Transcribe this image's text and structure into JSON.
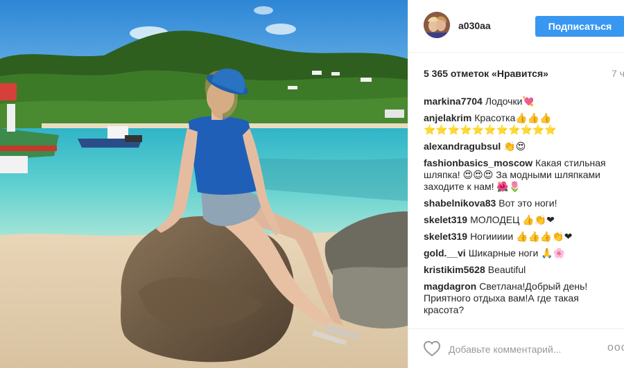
{
  "post": {
    "username": "a030aa",
    "follow_label": "Подписаться",
    "likes": "5 365 отметок «Нравится»",
    "time": "7 ч"
  },
  "comments": [
    {
      "user": "markina7704",
      "text": "Лодочки💘"
    },
    {
      "user": "anjelakrim",
      "text": "Красотка👍👍👍⭐⭐⭐⭐⭐⭐⭐⭐⭐⭐⭐"
    },
    {
      "user": "alexandragubsul",
      "text": "👏😍"
    },
    {
      "user": "fashionbasics_moscow",
      "text": "Какая стильная шляпка! 😍😍😍 За модными шляпками заходите к нам! 🌺🌷"
    },
    {
      "user": "shabelnikova83",
      "text": "Вот это ноги!"
    },
    {
      "user": "skelet319",
      "text": "МОЛОДЕЦ 👍👏❤"
    },
    {
      "user": "skelet319",
      "text": "Ногиииии 👍👍👍👏❤"
    },
    {
      "user": "gold.__vi",
      "text": "Шикарные ноги 🙏🌸"
    },
    {
      "user": "kristikim5628",
      "text": "Beautiful"
    },
    {
      "user": "magdagron",
      "text": "Светлана!Добрый день!Приятного отдыха вам!А где такая красота?"
    }
  ],
  "footer": {
    "comment_placeholder": "Добавьте комментарий...",
    "more_label": "ooo",
    "heart_icon": "heart-outline-icon"
  },
  "colors": {
    "accent": "#3897f0",
    "text": "#262626",
    "muted": "#999999"
  }
}
